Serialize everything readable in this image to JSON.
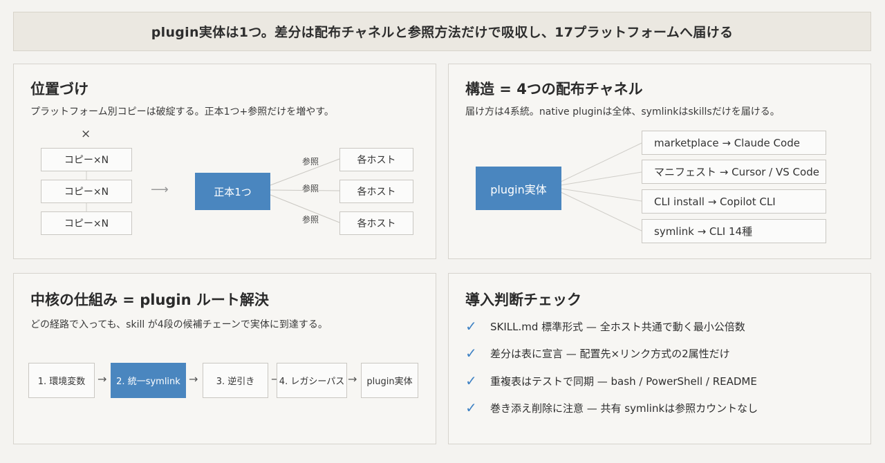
{
  "banner": "plugin実体は1つ。差分は配布チャネルと参照方法だけで吸収し、17プラットフォームへ届ける",
  "panel1": {
    "title": "位置づけ",
    "subtitle": "プラットフォーム別コピーは破綻する。正本1つ+参照だけを増やす。",
    "cross": "×",
    "copies": [
      "コピー×N",
      "コピー×N",
      "コピー×N"
    ],
    "arrow": "⟶",
    "center": "正本1つ",
    "ref_labels": [
      "参照",
      "参照",
      "参照"
    ],
    "hosts": [
      "各ホスト",
      "各ホスト",
      "各ホスト"
    ]
  },
  "panel2": {
    "title": "構造 = 4つの配布チャネル",
    "subtitle": "届け方は4系統。native pluginは全体、symlinkはskillsだけを届ける。",
    "center": "plugin実体",
    "channels": [
      "marketplace → Claude Code",
      "マニフェスト → Cursor / VS Code",
      "CLI install → Copilot CLI",
      "symlink → CLI 14種"
    ]
  },
  "panel3": {
    "title": "中核の仕組み = plugin ルート解決",
    "subtitle": "どの経路で入っても、skill が4段の候補チェーンで実体に到達する。",
    "steps": [
      "1. 環境変数",
      "2. 統一symlink",
      "3. 逆引き",
      "4. レガシーパス",
      "plugin実体"
    ],
    "arrow": "→"
  },
  "panel4": {
    "title": "導入判断チェック",
    "check_icon": "✓",
    "items": [
      "SKILL.md 標準形式 — 全ホスト共通で動く最小公倍数",
      "差分は表に宣言 — 配置先×リンク方式の2属性だけ",
      "重複表はテストで同期 — bash / PowerShell / README",
      "巻き添え削除に注意 — 共有 symlinkは参照カウントなし"
    ]
  },
  "colors": {
    "accent": "#4a86bf",
    "check": "#3f82c4",
    "banner_bg": "#ebe8e1"
  }
}
